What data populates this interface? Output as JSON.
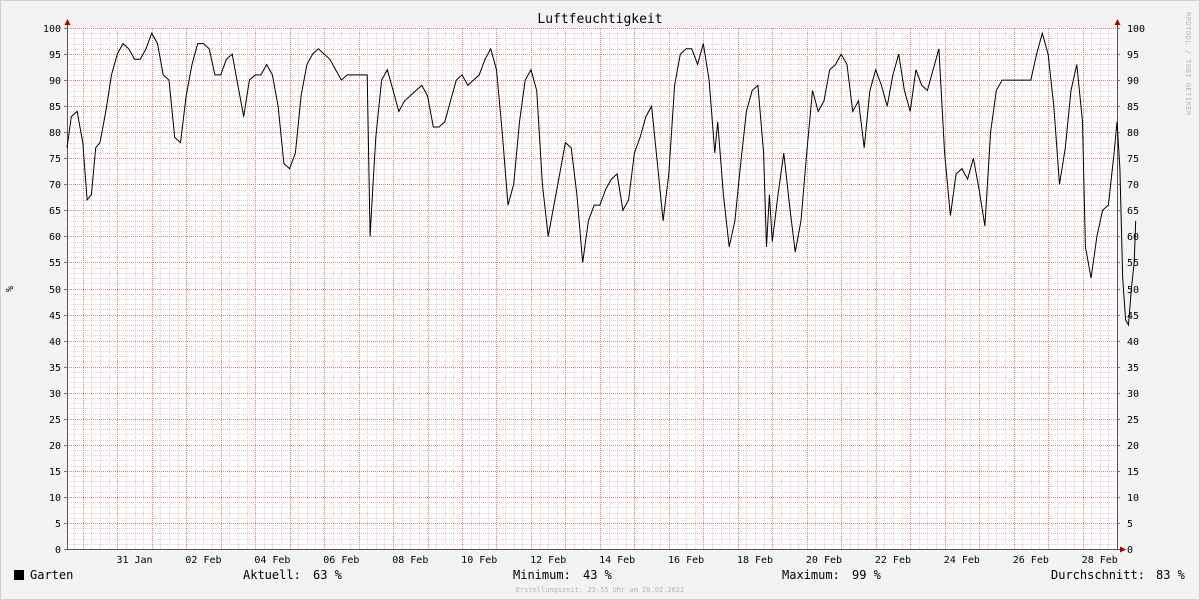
{
  "chart_data": {
    "type": "line",
    "title": "Luftfeuchtigkeit",
    "ylabel": "%",
    "ylim": [
      0,
      100
    ],
    "y_ticks": [
      0,
      5,
      10,
      15,
      20,
      25,
      30,
      35,
      40,
      45,
      50,
      55,
      60,
      65,
      70,
      75,
      80,
      85,
      90,
      95,
      100
    ],
    "x_range": [
      "2022-01-29T13:00",
      "2022-03-01T00:00"
    ],
    "x_ticks": [
      {
        "date": "2022-01-31",
        "label": "31 Jan"
      },
      {
        "date": "2022-02-02",
        "label": "02 Feb"
      },
      {
        "date": "2022-02-04",
        "label": "04 Feb"
      },
      {
        "date": "2022-02-06",
        "label": "06 Feb"
      },
      {
        "date": "2022-02-08",
        "label": "08 Feb"
      },
      {
        "date": "2022-02-10",
        "label": "10 Feb"
      },
      {
        "date": "2022-02-12",
        "label": "12 Feb"
      },
      {
        "date": "2022-02-14",
        "label": "14 Feb"
      },
      {
        "date": "2022-02-16",
        "label": "16 Feb"
      },
      {
        "date": "2022-02-18",
        "label": "18 Feb"
      },
      {
        "date": "2022-02-20",
        "label": "20 Feb"
      },
      {
        "date": "2022-02-22",
        "label": "22 Feb"
      },
      {
        "date": "2022-02-24",
        "label": "24 Feb"
      },
      {
        "date": "2022-02-26",
        "label": "26 Feb"
      },
      {
        "date": "2022-02-28",
        "label": "28 Feb"
      }
    ],
    "grid": true,
    "series": [
      {
        "name": "Garten",
        "color": "#000000",
        "points": [
          [
            "2022-01-29T13:00",
            77
          ],
          [
            "2022-01-29T16:00",
            83
          ],
          [
            "2022-01-29T20:00",
            84
          ],
          [
            "2022-01-30T00:00",
            78
          ],
          [
            "2022-01-30T03:00",
            67
          ],
          [
            "2022-01-30T06:00",
            68
          ],
          [
            "2022-01-30T09:00",
            77
          ],
          [
            "2022-01-30T12:00",
            78
          ],
          [
            "2022-01-30T16:00",
            84
          ],
          [
            "2022-01-30T20:00",
            91
          ],
          [
            "2022-01-31T00:00",
            95
          ],
          [
            "2022-01-31T04:00",
            97
          ],
          [
            "2022-01-31T08:00",
            96
          ],
          [
            "2022-01-31T12:00",
            94
          ],
          [
            "2022-01-31T16:00",
            94
          ],
          [
            "2022-01-31T20:00",
            96
          ],
          [
            "2022-02-01T00:00",
            99
          ],
          [
            "2022-02-01T04:00",
            97
          ],
          [
            "2022-02-01T08:00",
            91
          ],
          [
            "2022-02-01T12:00",
            90
          ],
          [
            "2022-02-01T16:00",
            79
          ],
          [
            "2022-02-01T20:00",
            78
          ],
          [
            "2022-02-02T00:00",
            87
          ],
          [
            "2022-02-02T04:00",
            93
          ],
          [
            "2022-02-02T08:00",
            97
          ],
          [
            "2022-02-02T12:00",
            97
          ],
          [
            "2022-02-02T16:00",
            96
          ],
          [
            "2022-02-02T20:00",
            91
          ],
          [
            "2022-02-03T00:00",
            91
          ],
          [
            "2022-02-03T04:00",
            94
          ],
          [
            "2022-02-03T08:00",
            95
          ],
          [
            "2022-02-03T12:00",
            89
          ],
          [
            "2022-02-03T16:00",
            83
          ],
          [
            "2022-02-03T20:00",
            90
          ],
          [
            "2022-02-04T00:00",
            91
          ],
          [
            "2022-02-04T04:00",
            91
          ],
          [
            "2022-02-04T08:00",
            93
          ],
          [
            "2022-02-04T12:00",
            91
          ],
          [
            "2022-02-04T16:00",
            85
          ],
          [
            "2022-02-04T20:00",
            74
          ],
          [
            "2022-02-05T00:00",
            73
          ],
          [
            "2022-02-05T04:00",
            76
          ],
          [
            "2022-02-05T08:00",
            87
          ],
          [
            "2022-02-05T12:00",
            93
          ],
          [
            "2022-02-05T16:00",
            95
          ],
          [
            "2022-02-05T20:00",
            96
          ],
          [
            "2022-02-06T00:00",
            95
          ],
          [
            "2022-02-06T04:00",
            94
          ],
          [
            "2022-02-06T08:00",
            92
          ],
          [
            "2022-02-06T12:00",
            90
          ],
          [
            "2022-02-06T16:00",
            91
          ],
          [
            "2022-02-07T00:00",
            91
          ],
          [
            "2022-02-07T06:00",
            91
          ],
          [
            "2022-02-07T08:00",
            60
          ],
          [
            "2022-02-07T10:00",
            70
          ],
          [
            "2022-02-07T12:00",
            79
          ],
          [
            "2022-02-07T16:00",
            90
          ],
          [
            "2022-02-07T20:00",
            92
          ],
          [
            "2022-02-08T00:00",
            88
          ],
          [
            "2022-02-08T04:00",
            84
          ],
          [
            "2022-02-08T08:00",
            86
          ],
          [
            "2022-02-08T12:00",
            87
          ],
          [
            "2022-02-08T16:00",
            88
          ],
          [
            "2022-02-08T20:00",
            89
          ],
          [
            "2022-02-09T00:00",
            87
          ],
          [
            "2022-02-09T04:00",
            81
          ],
          [
            "2022-02-09T08:00",
            81
          ],
          [
            "2022-02-09T12:00",
            82
          ],
          [
            "2022-02-09T16:00",
            86
          ],
          [
            "2022-02-09T20:00",
            90
          ],
          [
            "2022-02-10T00:00",
            91
          ],
          [
            "2022-02-10T04:00",
            89
          ],
          [
            "2022-02-10T08:00",
            90
          ],
          [
            "2022-02-10T12:00",
            91
          ],
          [
            "2022-02-10T16:00",
            94
          ],
          [
            "2022-02-10T20:00",
            96
          ],
          [
            "2022-02-11T00:00",
            92
          ],
          [
            "2022-02-11T04:00",
            80
          ],
          [
            "2022-02-11T08:00",
            66
          ],
          [
            "2022-02-11T12:00",
            70
          ],
          [
            "2022-02-11T16:00",
            82
          ],
          [
            "2022-02-11T20:00",
            90
          ],
          [
            "2022-02-12T00:00",
            92
          ],
          [
            "2022-02-12T04:00",
            88
          ],
          [
            "2022-02-12T08:00",
            70
          ],
          [
            "2022-02-12T12:00",
            60
          ],
          [
            "2022-02-12T16:00",
            66
          ],
          [
            "2022-02-12T20:00",
            72
          ],
          [
            "2022-02-13T00:00",
            78
          ],
          [
            "2022-02-13T04:00",
            77
          ],
          [
            "2022-02-13T08:00",
            68
          ],
          [
            "2022-02-13T12:00",
            55
          ],
          [
            "2022-02-13T16:00",
            63
          ],
          [
            "2022-02-13T20:00",
            66
          ],
          [
            "2022-02-14T00:00",
            66
          ],
          [
            "2022-02-14T04:00",
            69
          ],
          [
            "2022-02-14T08:00",
            71
          ],
          [
            "2022-02-14T12:00",
            72
          ],
          [
            "2022-02-14T16:00",
            65
          ],
          [
            "2022-02-14T20:00",
            67
          ],
          [
            "2022-02-15T00:00",
            76
          ],
          [
            "2022-02-15T04:00",
            79
          ],
          [
            "2022-02-15T08:00",
            83
          ],
          [
            "2022-02-15T12:00",
            85
          ],
          [
            "2022-02-15T16:00",
            74
          ],
          [
            "2022-02-15T20:00",
            63
          ],
          [
            "2022-02-16T00:00",
            72
          ],
          [
            "2022-02-16T04:00",
            89
          ],
          [
            "2022-02-16T08:00",
            95
          ],
          [
            "2022-02-16T12:00",
            96
          ],
          [
            "2022-02-16T16:00",
            96
          ],
          [
            "2022-02-16T20:00",
            93
          ],
          [
            "2022-02-17T00:00",
            97
          ],
          [
            "2022-02-17T04:00",
            90
          ],
          [
            "2022-02-17T08:00",
            76
          ],
          [
            "2022-02-17T10:00",
            82
          ],
          [
            "2022-02-17T14:00",
            68
          ],
          [
            "2022-02-17T18:00",
            58
          ],
          [
            "2022-02-17T22:00",
            63
          ],
          [
            "2022-02-18T02:00",
            74
          ],
          [
            "2022-02-18T06:00",
            84
          ],
          [
            "2022-02-18T10:00",
            88
          ],
          [
            "2022-02-18T14:00",
            89
          ],
          [
            "2022-02-18T18:00",
            76
          ],
          [
            "2022-02-18T20:00",
            58
          ],
          [
            "2022-02-18T22:00",
            68
          ],
          [
            "2022-02-19T00:00",
            59
          ],
          [
            "2022-02-19T04:00",
            68
          ],
          [
            "2022-02-19T08:00",
            76
          ],
          [
            "2022-02-19T12:00",
            66
          ],
          [
            "2022-02-19T16:00",
            57
          ],
          [
            "2022-02-19T20:00",
            63
          ],
          [
            "2022-02-20T00:00",
            76
          ],
          [
            "2022-02-20T04:00",
            88
          ],
          [
            "2022-02-20T08:00",
            84
          ],
          [
            "2022-02-20T12:00",
            86
          ],
          [
            "2022-02-20T16:00",
            92
          ],
          [
            "2022-02-20T20:00",
            93
          ],
          [
            "2022-02-21T00:00",
            95
          ],
          [
            "2022-02-21T04:00",
            93
          ],
          [
            "2022-02-21T08:00",
            84
          ],
          [
            "2022-02-21T12:00",
            86
          ],
          [
            "2022-02-21T16:00",
            77
          ],
          [
            "2022-02-21T20:00",
            88
          ],
          [
            "2022-02-22T00:00",
            92
          ],
          [
            "2022-02-22T04:00",
            89
          ],
          [
            "2022-02-22T08:00",
            85
          ],
          [
            "2022-02-22T12:00",
            91
          ],
          [
            "2022-02-22T16:00",
            95
          ],
          [
            "2022-02-22T20:00",
            88
          ],
          [
            "2022-02-23T00:00",
            84
          ],
          [
            "2022-02-23T04:00",
            92
          ],
          [
            "2022-02-23T08:00",
            89
          ],
          [
            "2022-02-23T12:00",
            88
          ],
          [
            "2022-02-23T16:00",
            92
          ],
          [
            "2022-02-23T20:00",
            96
          ],
          [
            "2022-02-24T00:00",
            76
          ],
          [
            "2022-02-24T04:00",
            64
          ],
          [
            "2022-02-24T08:00",
            72
          ],
          [
            "2022-02-24T12:00",
            73
          ],
          [
            "2022-02-24T16:00",
            71
          ],
          [
            "2022-02-24T20:00",
            75
          ],
          [
            "2022-02-25T00:00",
            69
          ],
          [
            "2022-02-25T04:00",
            62
          ],
          [
            "2022-02-25T08:00",
            80
          ],
          [
            "2022-02-25T12:00",
            88
          ],
          [
            "2022-02-25T16:00",
            90
          ],
          [
            "2022-02-26T00:00",
            90
          ],
          [
            "2022-02-26T12:00",
            90
          ],
          [
            "2022-02-26T16:00",
            95
          ],
          [
            "2022-02-26T20:00",
            99
          ],
          [
            "2022-02-27T00:00",
            95
          ],
          [
            "2022-02-27T04:00",
            85
          ],
          [
            "2022-02-27T08:00",
            70
          ],
          [
            "2022-02-27T12:00",
            77
          ],
          [
            "2022-02-27T16:00",
            88
          ],
          [
            "2022-02-27T20:00",
            93
          ],
          [
            "2022-02-28T00:00",
            82
          ],
          [
            "2022-02-28T02:00",
            58
          ],
          [
            "2022-02-28T06:00",
            52
          ],
          [
            "2022-02-28T10:00",
            60
          ],
          [
            "2022-02-28T14:00",
            65
          ],
          [
            "2022-02-28T18:00",
            66
          ],
          [
            "2022-02-28T22:00",
            76
          ],
          [
            "2022-03-01T00:00",
            82
          ],
          [
            "2022-03-01T02:00",
            73
          ],
          [
            "2022-03-01T04:00",
            52
          ],
          [
            "2022-03-01T06:00",
            44
          ],
          [
            "2022-03-01T08:00",
            43
          ],
          [
            "2022-03-01T10:00",
            50
          ],
          [
            "2022-03-01T12:00",
            55
          ],
          [
            "2022-03-01T13:00",
            63
          ]
        ]
      }
    ]
  },
  "side_label": "RRDTOOL / TOBI OETIKER",
  "legend": {
    "name": "Garten",
    "current_label": "Aktuell:",
    "current_value": "63 %",
    "min_label": "Minimum:",
    "min_value": "43 %",
    "max_label": "Maximum:",
    "max_value": "99 %",
    "avg_label": "Durchschnitt:",
    "avg_value": "83 %"
  },
  "footer": "Erstellungszeit: 23:55 Uhr am 28.02.2022",
  "colors": {
    "canvas": "#ffffff",
    "background": "#f3f3f3",
    "major_grid": "#e08080",
    "minor_grid": "#eecccc",
    "line": "#000000",
    "arrow": "#aa0000"
  }
}
